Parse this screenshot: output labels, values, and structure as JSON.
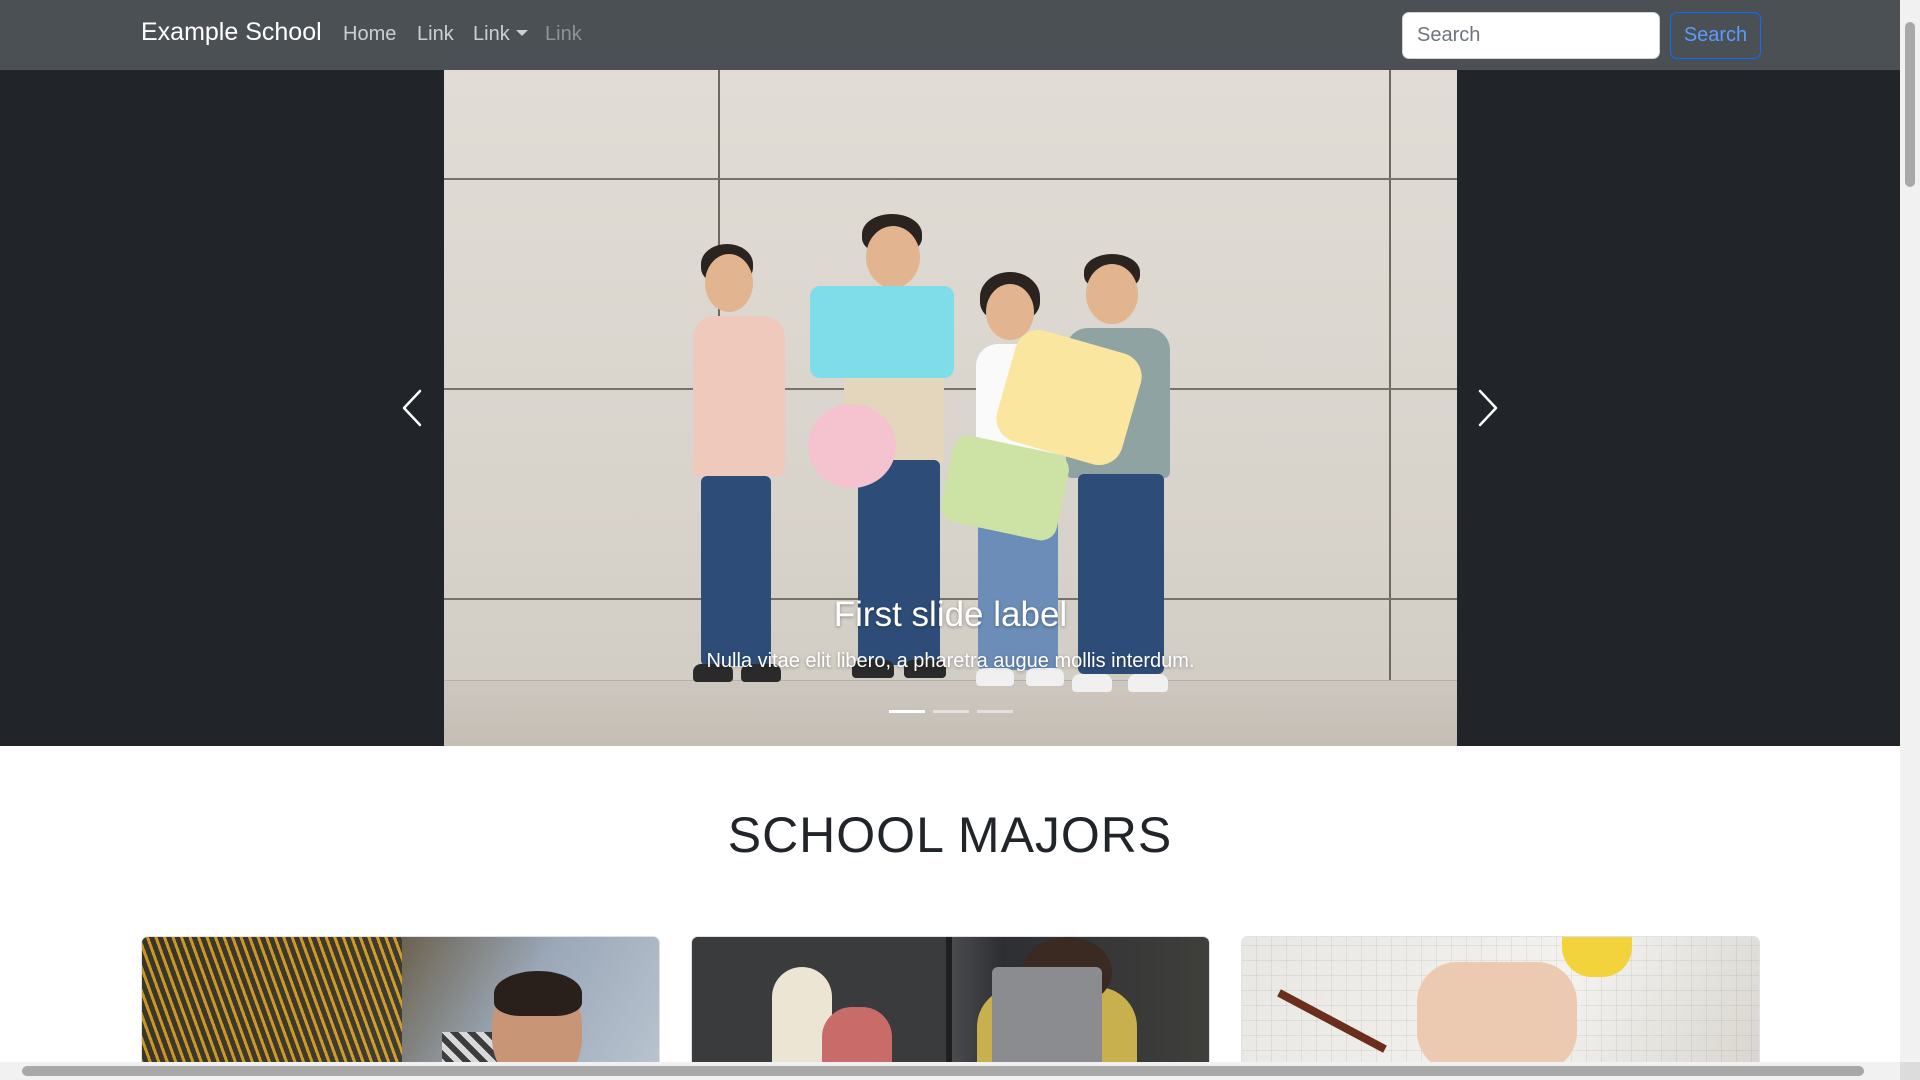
{
  "navbar": {
    "brand": "Example School",
    "links": [
      "Home",
      "Link",
      "Link",
      "Link"
    ],
    "search_placeholder": "Search",
    "search_button": "Search"
  },
  "carousel": {
    "caption_title": "First slide label",
    "caption_text": "Nulla vitae elit libero, a pharetra augue mollis interdum.",
    "active_slide": 1,
    "slide_count": 3,
    "prev_icon": "chevron-left-icon",
    "next_icon": "chevron-right-icon"
  },
  "section": {
    "title": "SCHOOL MAJORS"
  },
  "colors": {
    "navbar_bg": "#4b5055",
    "carousel_bg": "#212529",
    "primary": "#0d6efd",
    "text_dark": "#212529"
  }
}
